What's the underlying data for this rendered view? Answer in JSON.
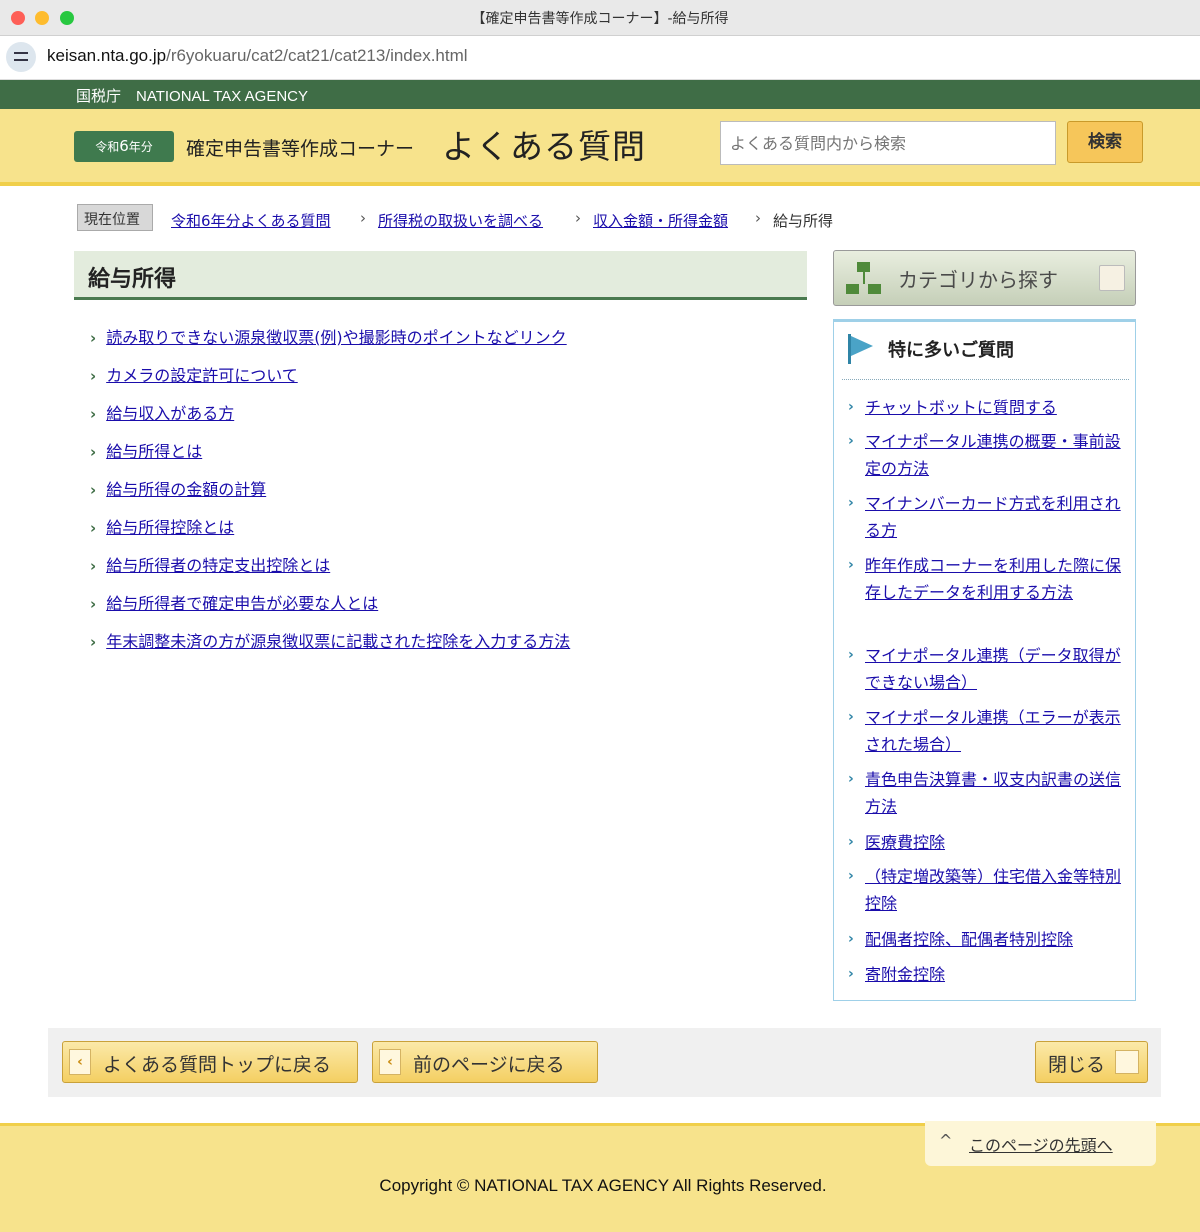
{
  "window": {
    "title": "【確定申告書等作成コーナー】-給与所得"
  },
  "address": {
    "host": "keisan.nta.go.jp",
    "path": "/r6yokuaru/cat2/cat21/cat213/index.html"
  },
  "agency": {
    "label": "国税庁　NATIONAL TAX AGENCY"
  },
  "header": {
    "year_prefix": "令和",
    "year_number": "6",
    "year_suffix": "年分",
    "corner_name": "確定申告書等作成コーナー",
    "faq_title": "よくある質問",
    "search_placeholder": "よくある質問内から検索",
    "search_button": "検索"
  },
  "breadcrumb": {
    "current_label": "現在位置",
    "items": [
      "令和6年分よくある質問",
      "所得税の取扱いを調べる",
      "収入金額・所得金額"
    ],
    "last": "給与所得"
  },
  "main": {
    "heading": "給与所得",
    "items": [
      "読み取りできない源泉徴収票(例)や撮影時のポイントなどリンク",
      "カメラの設定許可について",
      "給与収入がある方",
      "給与所得とは",
      "給与所得の金額の計算",
      "給与所得控除とは",
      "給与所得者の特定支出控除とは",
      "給与所得者で確定申告が必要な人とは",
      "年末調整未済の方が源泉徴収票に記載された控除を入力する方法"
    ]
  },
  "sidebar": {
    "category_button": "カテゴリから探す",
    "faq_title": "特に多いご質問",
    "items": [
      "チャットボットに質問する",
      "マイナポータル連携の概要・事前設定の方法",
      "マイナンバーカード方式を利用される方",
      "昨年作成コーナーを利用した際に保存したデータを利用する方法",
      "マイナポータル連携（データ取得ができない場合）",
      "マイナポータル連携（エラーが表示された場合）",
      "青色申告決算書・収支内訳書の送信方法",
      "医療費控除",
      "（特定増改築等）住宅借入金等特別控除",
      "配偶者控除、配偶者特別控除",
      "寄附金控除"
    ]
  },
  "bottom_nav": {
    "faq_top": "よくある質問トップに戻る",
    "prev_page": "前のページに戻る",
    "close": "閉じる"
  },
  "footer": {
    "page_top": "このページの先頭へ",
    "copyright": "Copyright © NATIONAL TAX AGENCY All Rights Reserved."
  },
  "colors": {
    "agency_bar": "#3f6d46",
    "header_bg": "#f7e38c",
    "link": "#1a0dab",
    "accent_green": "#4a7a4f",
    "sidebar_border": "#9fd0e8"
  }
}
